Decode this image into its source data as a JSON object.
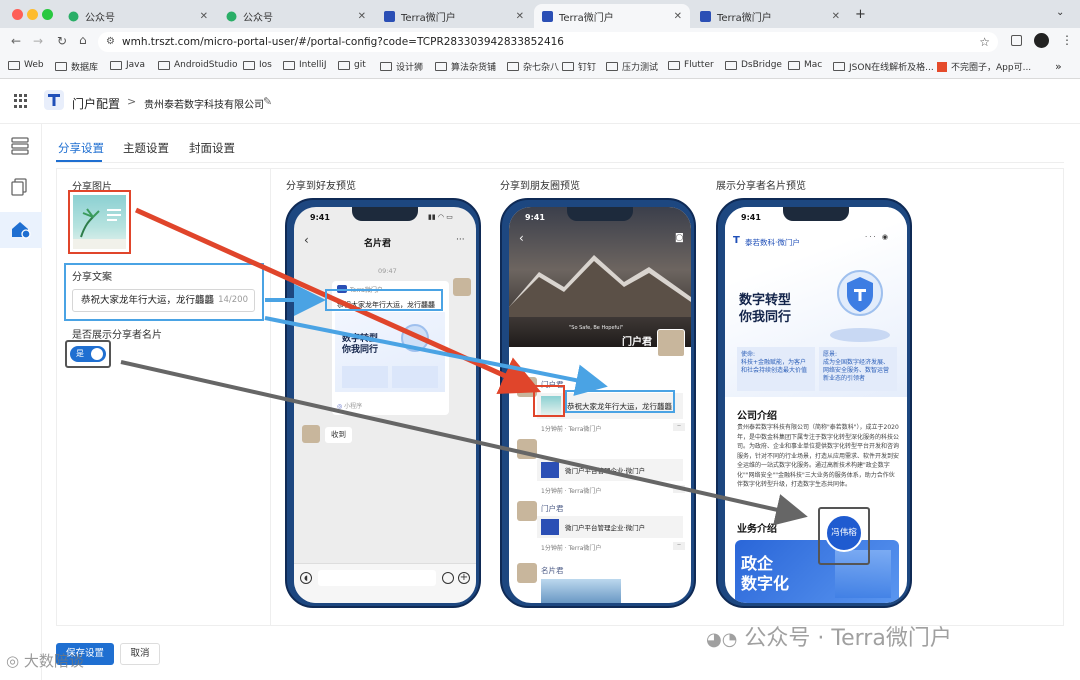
{
  "browser": {
    "tabs": [
      "公众号",
      "公众号",
      "Terra微门户",
      "Terra微门户",
      "Terra微门户"
    ],
    "new_tab": "+",
    "url": "wmh.trszt.com/micro-portal-user/#/portal-config?code=TCPR283303942833852416",
    "bookmarks": [
      "Web",
      "数据库",
      "Java",
      "AndroidStudio",
      "Ios",
      "IntelliJ",
      "git",
      "设计狮",
      "算法杂货铺",
      "杂七杂八",
      "钉钉",
      "压力测试",
      "Flutter",
      "DsBridge",
      "Mac",
      "JSON在线解析及格...",
      "不完圈子，App可..."
    ],
    "more": "»",
    "colors": {
      "tabbar": "#dfe3e8",
      "toolbar": "#f6f7f9"
    }
  },
  "app": {
    "title": "门户配置",
    "breadcrumb_sep": ">",
    "company": "贵州泰若数字科技有限公司",
    "tabs": [
      "分享设置",
      "主题设置",
      "封面设置"
    ],
    "accent": "#1f6fd1"
  },
  "form": {
    "share_image_label": "分享图片",
    "share_copy_label": "分享文案",
    "share_copy_value": "恭祝大家龙年行大运，龙行龘龘",
    "share_copy_count": "14/200",
    "show_card_label": "是否展示分享者名片",
    "toggle_text": "是",
    "save_button": "保存设置",
    "cancel_button": "取消"
  },
  "preview1": {
    "label": "分享到好友预览",
    "time": "9:41",
    "chat_title": "名片君",
    "msg_time": "09:47",
    "card_brand": "Terra微门户",
    "card_text": "恭祝大家龙年行大运，龙行龘龘",
    "card_headline": "数字转型\n你我同行",
    "mini_program": "小程序",
    "reply": "收到"
  },
  "preview2": {
    "label": "分享到朋友圈预览",
    "time": "9:41",
    "cover_name": "门户君",
    "cover_quote": "\"So Safe, Be Hopeful\"",
    "post_name": "门户君",
    "post_text": "恭祝大家龙年行大运，龙行龘龘",
    "post_meta": "1分钟前 · Terra微门户",
    "feeds": [
      {
        "text": "微门户平台管理企业·微门户",
        "meta": "1分钟前 · Terra微门户"
      },
      {
        "name": "门户君",
        "text": "微门户平台管理企业·微门户",
        "meta": "1分钟前 · Terra微门户"
      },
      {
        "name": "名片君"
      }
    ]
  },
  "preview3": {
    "label": "展示分享者名片预览",
    "time": "9:41",
    "logo": "泰若数科·微门户",
    "headline1": "数字转型",
    "headline2": "你我同行",
    "mission_label": "使命:",
    "mission": "科技+金融赋能，为客户和社会持续创造最大价值",
    "vision_label": "愿景:",
    "vision": "成为全国数字经济发展、网络安全服务、数智运营新业态的引领者",
    "intro_title": "公司介绍",
    "intro_text": "贵州泰若数字科技有限公司（简称\"泰若数科\"），成立于2020年，是中数金科集团下属专注于数字化转型深化服务的科技公司。为政府、企业和事业单位提供数字化转型平台开发和咨询服务，针对不同的行业场景，打造从应用需求、软件开发到安全运维的一站式数字化服务。通过高新技术构建\"政企数字化\"\"网络安全\"\"金融科技\"三大业务的服务体系，助力合作伙伴数字化转型升级，打造数字生态共同体。",
    "business_title": "业务介绍",
    "banner_line1": "政企",
    "banner_line2": "数字化",
    "badge_name": "冯伟榕"
  },
  "watermark": {
    "text": "公众号 · Terra微门户",
    "corner": "大数陪谈"
  }
}
